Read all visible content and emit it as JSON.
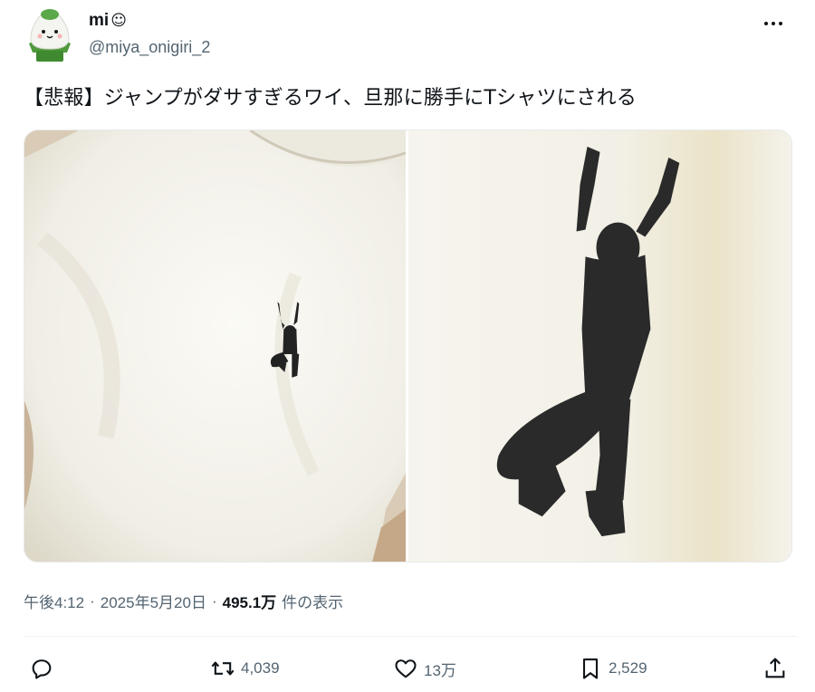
{
  "author": {
    "display_name": "mi",
    "name_emoji": "☺",
    "handle": "@miya_onigiri_2"
  },
  "tweet": {
    "text": "【悲報】ジャンプがダサすぎるワイ、旦那に勝手にTシャツにされる"
  },
  "meta": {
    "time": "午後4:12",
    "date": "2025年5月20日",
    "views_count": "495.1万",
    "views_label": "件の表示"
  },
  "actions": {
    "reply_count": "",
    "retweet_count": "4,039",
    "like_count": "13万",
    "bookmark_count": "2,529"
  },
  "colors": {
    "text_primary": "#0f1419",
    "text_secondary": "#536471",
    "divider": "#eff3f4"
  },
  "icons": [
    "onigiri-avatar-icon",
    "more-icon",
    "reply-icon",
    "retweet-icon",
    "like-icon",
    "bookmark-icon",
    "share-icon"
  ]
}
